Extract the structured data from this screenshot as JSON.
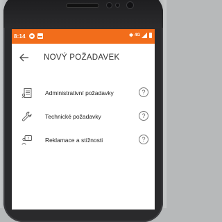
{
  "status_bar": {
    "time": "8:14",
    "network": "4G",
    "bluetooth": "✱",
    "color": "#f26d1b"
  },
  "app_bar": {
    "title": "NOVÝ POŽADAVEK",
    "back_icon": "arrow-left-icon"
  },
  "items": [
    {
      "label": "Administrativní požadavky",
      "icon": "document-icon",
      "help": "?"
    },
    {
      "label": "Technické požadavky",
      "icon": "wrench-icon",
      "help": "?"
    },
    {
      "label": "Reklamace a stížnosti",
      "icon": "complaint-icon",
      "help": "?"
    }
  ]
}
